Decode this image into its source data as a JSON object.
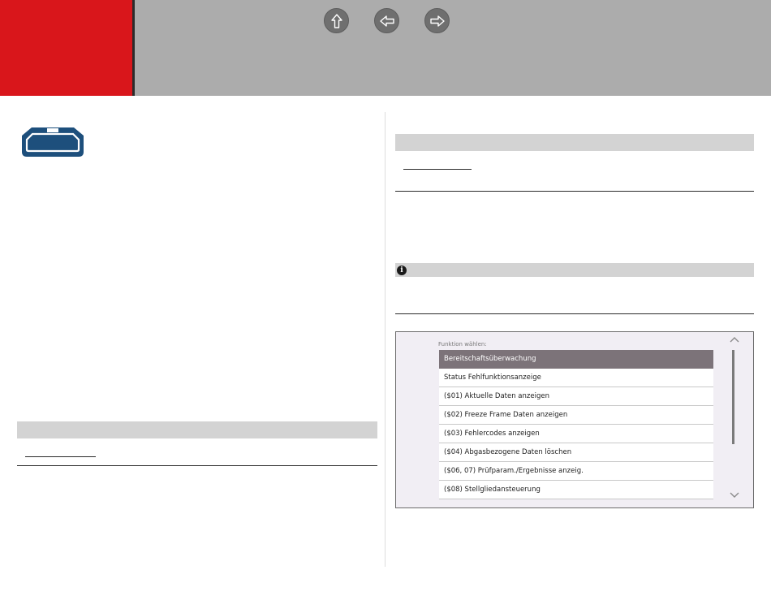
{
  "nav": {
    "buttons": [
      {
        "name": "home",
        "icon": "up-arrow-icon"
      },
      {
        "name": "back",
        "icon": "left-arrow-icon"
      },
      {
        "name": "forward",
        "icon": "right-arrow-icon"
      }
    ]
  },
  "colors": {
    "header_gray": "#acacac",
    "header_red": "#d9161b",
    "connector_blue": "#1d4f7c",
    "selected_row": "#7c7379"
  },
  "screenshot": {
    "label": "Funktion wählen:",
    "items": [
      "Bereitschaftsüberwachung",
      "Status Fehlfunktionsanzeige",
      "($01) Aktuelle Daten anzeigen",
      "($02) Freeze Frame Daten anzeigen",
      "($03) Fehlercodes anzeigen",
      "($04) Abgasbezogene Daten löschen",
      "($06, 07) Prüfparam./Ergebnisse anzeig.",
      "($08) Stellgliedansteuerung"
    ],
    "selected_index": 0
  }
}
